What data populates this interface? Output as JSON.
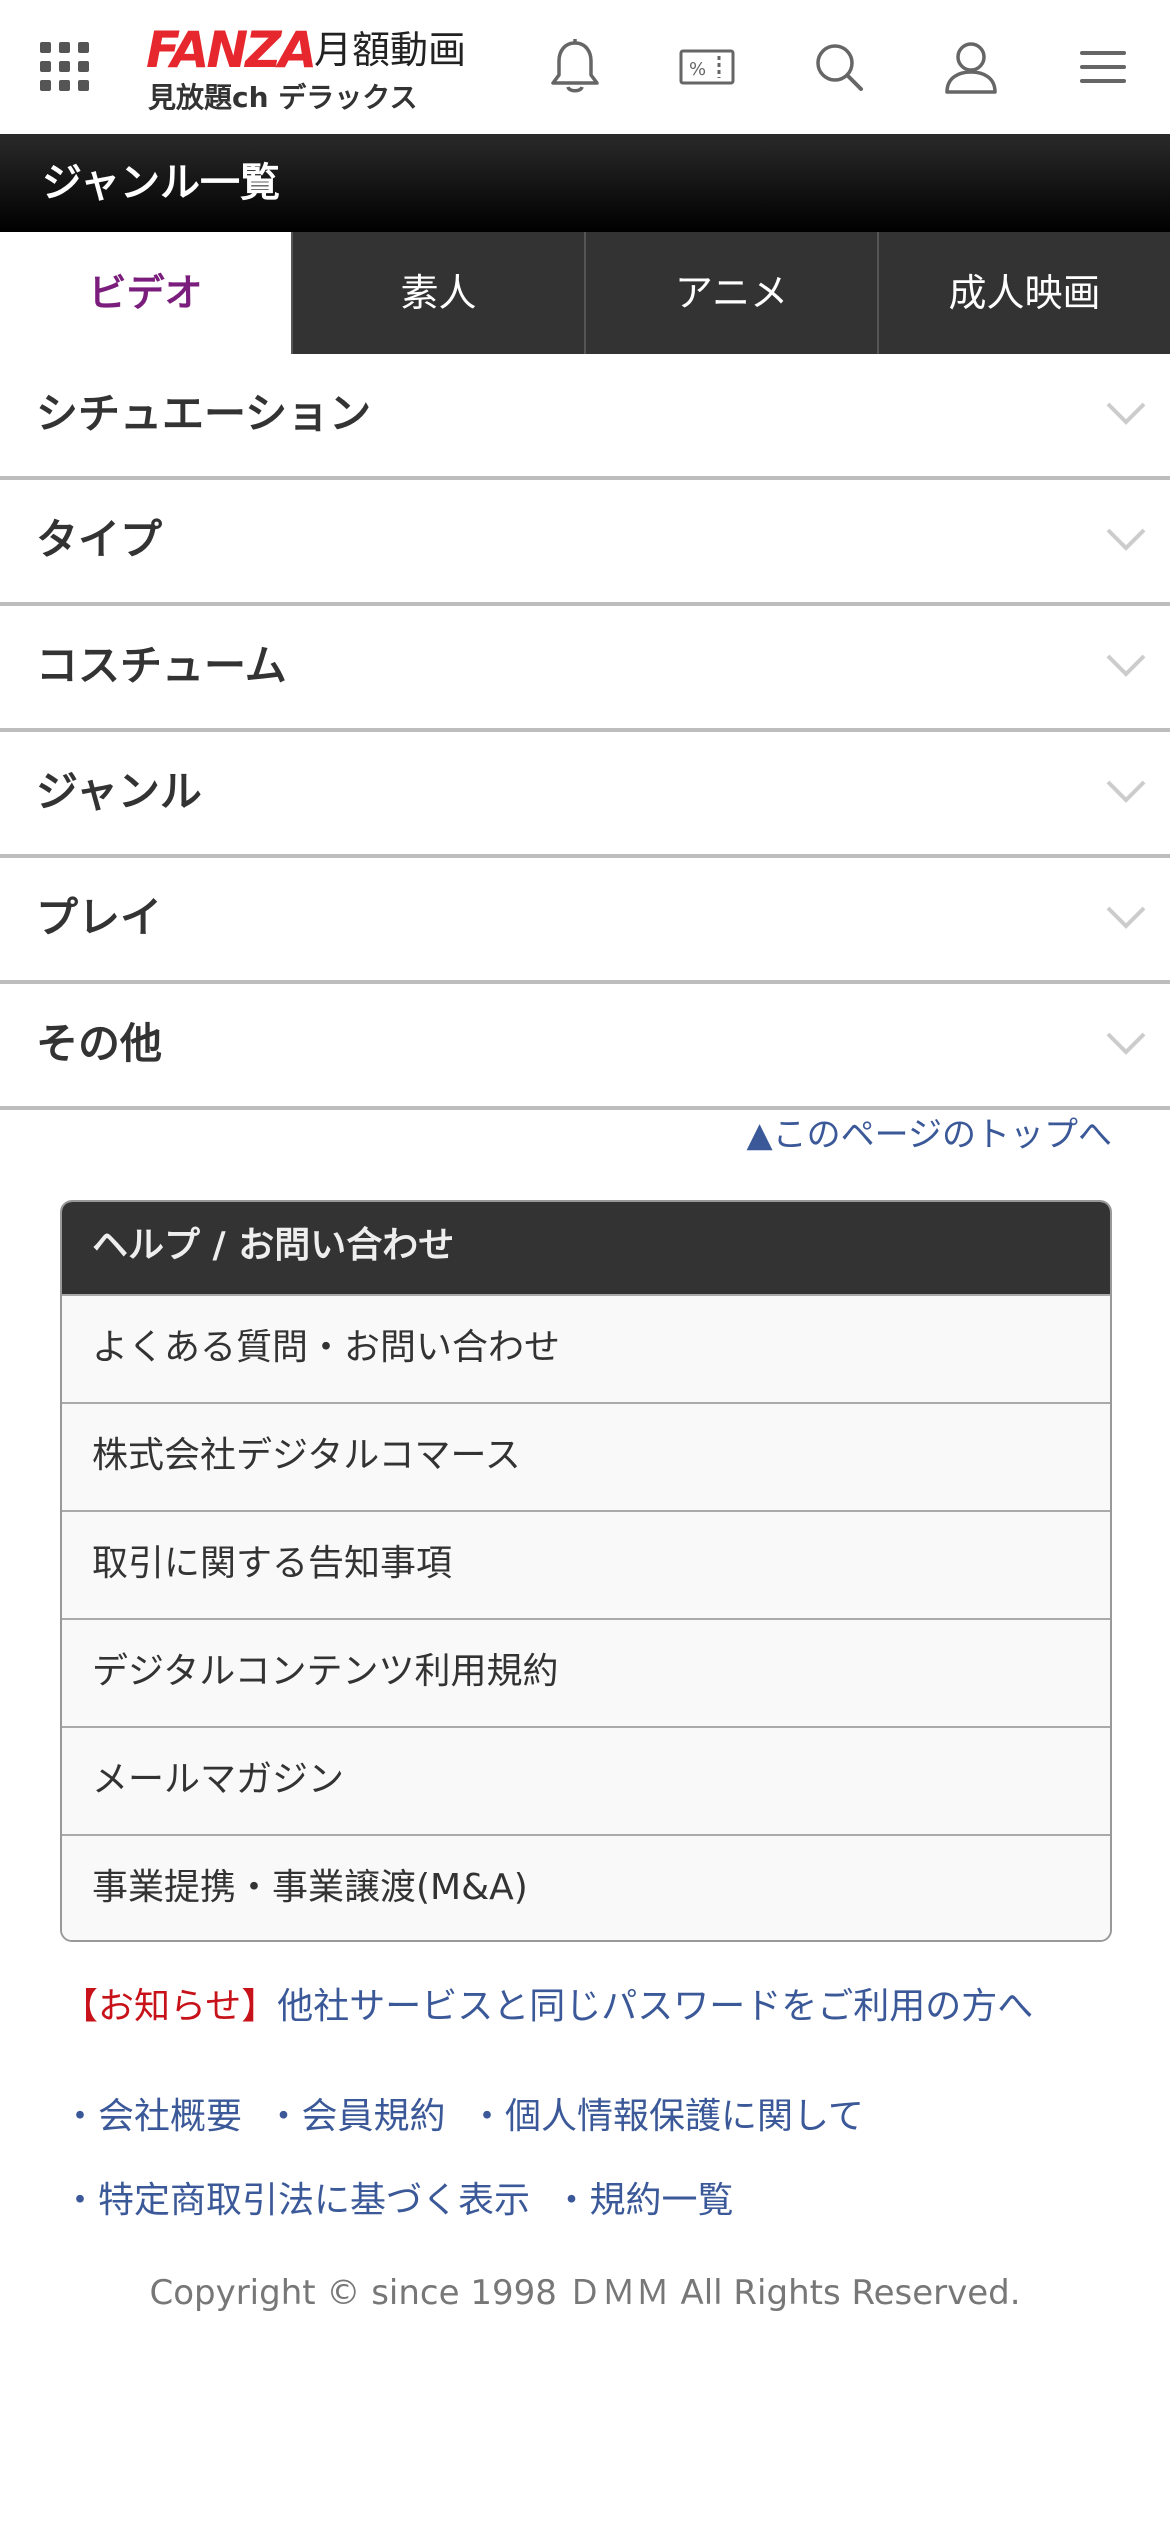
{
  "header": {
    "brand": "FANZA",
    "title": "月額動画",
    "subtitle": "見放題ch デラックス",
    "icons": [
      "apps-grid-icon",
      "bell-icon",
      "coupon-icon",
      "search-icon",
      "user-icon",
      "menu-icon"
    ]
  },
  "titlebar": {
    "title": "ジャンル一覧"
  },
  "tabs": [
    {
      "label": "ビデオ",
      "active": true
    },
    {
      "label": "素人",
      "active": false
    },
    {
      "label": "アニメ",
      "active": false
    },
    {
      "label": "成人映画",
      "active": false
    }
  ],
  "accordion": [
    {
      "label": "シチュエーション"
    },
    {
      "label": "タイプ"
    },
    {
      "label": "コスチューム"
    },
    {
      "label": "ジャンル"
    },
    {
      "label": "プレイ"
    },
    {
      "label": "その他"
    }
  ],
  "pagetop": {
    "label": "▲このページのトップへ"
  },
  "help": {
    "title": "ヘルプ / お問い合わせ",
    "items": [
      "よくある質問・お問い合わせ",
      "株式会社デジタルコマース",
      "取引に関する告知事項",
      "デジタルコンテンツ利用規約",
      "メールマガジン",
      "事業提携・事業譲渡(M&A)"
    ]
  },
  "notice": {
    "label": "【お知らせ】",
    "link": "他社サービスと同じパスワードをご利用の方へ"
  },
  "footer_links": {
    "row1": [
      "・会社概要",
      "・会員規約",
      "・個人情報保護に関して"
    ],
    "row2": [
      "・特定商取引法に基づく表示",
      "・規約一覧"
    ]
  },
  "copyright": "Copyright © since 1998 ＤＭＭ All Rights Reserved.",
  "colors": {
    "brand_red": "#e6282e",
    "active_tab": "#7a1d7c",
    "link_blue": "#3b5998",
    "notice_red": "#c8121a"
  }
}
